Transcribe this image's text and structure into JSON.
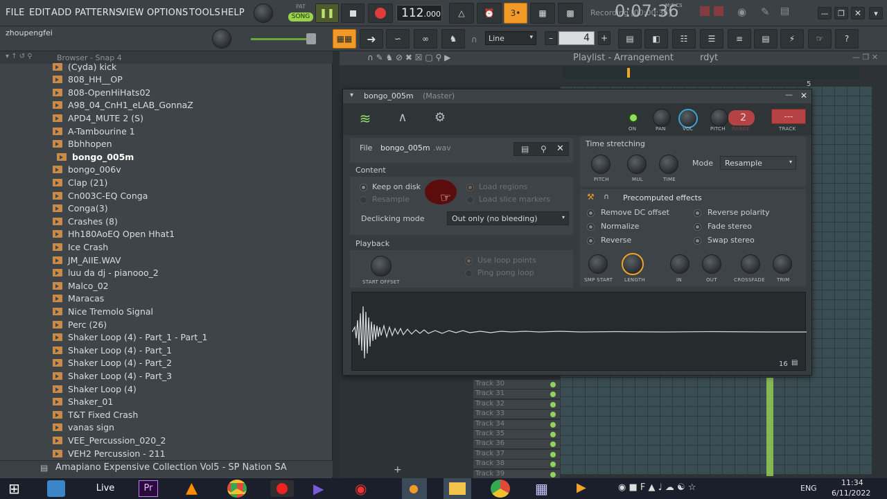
{
  "menu": [
    "FILE",
    "EDIT",
    "ADD",
    "PATTERNS",
    "VIEW",
    "OPTIONS",
    "TOOLS",
    "HELP"
  ],
  "transport": {
    "pat": "PAT",
    "song": "SONG",
    "tempo": "112",
    "tempo_dec": ".000",
    "recording": "Recording [00:00:36]",
    "time": "0:07:36",
    "msc": "M:S:CS"
  },
  "hint": {
    "user": "zhoupengfei"
  },
  "toolbar2": {
    "snap": "Line",
    "step": "4"
  },
  "browser": {
    "title": "Browser - Snap 4",
    "items": [
      "(Cyda) kick",
      "808_HH__OP",
      "808-OpenHiHats02",
      "A98_04_CnH1_eLAB_GonnaZ",
      "APD4_MUTE 2 (S)",
      "A-Tambourine 1",
      "Bbhhopen",
      "bongo_005m",
      "bongo_006v",
      "Clap (21)",
      "Cn003C-EQ Conga",
      "Conga(3)",
      "Crashes (8)",
      "Hh180AoEQ Open Hhat1",
      "Ice Crash",
      "JM_AIIE.WAV",
      "luu da dj - pianooo_2",
      "Malco_02",
      "Maracas",
      "Nice Tremolo Signal",
      "Perc (26)",
      "Shaker Loop (4) - Part_1 - Part_1",
      "Shaker Loop (4) - Part_1",
      "Shaker Loop (4) - Part_2",
      "Shaker Loop (4) - Part_3",
      "Shaker Loop (4)",
      "Shaker_01",
      "T&T Fixed Crash",
      "vanas sign",
      "VEE_Percussion_020_2",
      "VEH2 Percussion - 211"
    ],
    "footer": "Amapiano Expensive Collection Vol5 - SP Nation SA"
  },
  "playlist": {
    "title": "Playlist - Arrangement",
    "pattern": "rdyt",
    "bar": "5",
    "tracks": [
      "Track 30",
      "Track 31",
      "Track 32",
      "Track 33",
      "Track 34",
      "Track 35",
      "Track 36",
      "Track 37",
      "Track 38",
      "Track 39"
    ]
  },
  "sampler": {
    "title": "bongo_005m",
    "title_suffix": "(Master)",
    "top": {
      "on": "ON",
      "pan": "PAN",
      "vol": "VOL",
      "pitch": "PITCH",
      "range": "RANGE",
      "range_val": "2",
      "track": "TRACK",
      "track_val": "---"
    },
    "file_label": "File",
    "file_name": "bongo_005m",
    "file_ext": ".wav",
    "content": "Content",
    "keep_on_disk": "Keep on disk",
    "resample": "Resample",
    "load_regions": "Load regions",
    "load_slice": "Load slice markers",
    "declick_label": "Declicking mode",
    "declick_val": "Out only (no bleeding)",
    "playback": "Playback",
    "start_offset": "START OFFSET",
    "use_loop": "Use loop points",
    "ping_pong": "Ping pong loop",
    "time_stretching": "Time stretching",
    "ts_pitch": "PITCH",
    "ts_mul": "MUL",
    "ts_time": "TIME",
    "mode_label": "Mode",
    "mode_val": "Resample",
    "precomputed": "Precomputed effects",
    "remove_dc": "Remove DC offset",
    "normalize": "Normalize",
    "reverse": "Reverse",
    "reverse_pol": "Reverse polarity",
    "fade_stereo": "Fade stereo",
    "swap_stereo": "Swap stereo",
    "k_smp": "SMP START",
    "k_len": "LENGTH",
    "k_in": "IN",
    "k_out": "OUT",
    "k_cross": "CROSSFADE",
    "k_trim": "TRIM",
    "wave_bits": "16"
  },
  "taskbar": {
    "live": "Live",
    "pr": "Pr",
    "lang": "ENG",
    "time": "11:34",
    "date": "6/11/2022"
  },
  "colors": {
    "accent": "#f29a28",
    "green": "#8fd45c",
    "red": "#d84a4a"
  }
}
